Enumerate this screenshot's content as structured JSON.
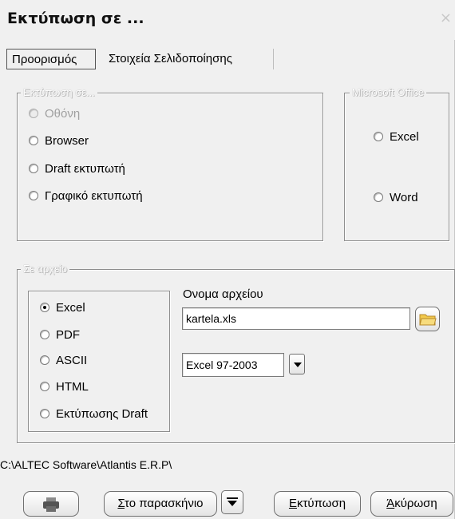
{
  "window": {
    "title": "Εκτύπωση σε ...",
    "close_glyph": "×"
  },
  "tabs": [
    {
      "label": "Προορισμός",
      "active": true
    },
    {
      "label": "Στοιχεία Σελιδοποίησης",
      "active": false
    }
  ],
  "print_to": {
    "legend": "Εκτύπωση σε...",
    "options": [
      {
        "label": "Οθόνη",
        "disabled": true,
        "selected": false
      },
      {
        "label": "Browser",
        "disabled": false,
        "selected": false
      },
      {
        "label": "Draft εκτυπωτή",
        "disabled": false,
        "selected": false
      },
      {
        "label": "Γραφικό εκτυπωτή",
        "disabled": false,
        "selected": false
      }
    ]
  },
  "office": {
    "legend": "Microsoft Office",
    "options": [
      {
        "label": "Excel",
        "selected": false
      },
      {
        "label": "Word",
        "selected": false
      }
    ]
  },
  "to_file": {
    "legend": "Σε αρχείο",
    "formats": [
      {
        "label": "Excel",
        "selected": true
      },
      {
        "label": "PDF",
        "selected": false
      },
      {
        "label": "ASCII",
        "selected": false
      },
      {
        "label": "HTML",
        "selected": false
      },
      {
        "label": "Εκτύπωσης Draft",
        "selected": false
      }
    ],
    "filename_label": "Ονομα αρχείου",
    "filename_value": "kartela.xls",
    "browse_icon": "folder-icon",
    "version_value": "Excel 97-2003"
  },
  "status_path": "C:\\ALTEC Software\\Atlantis E.R.P\\",
  "buttons": {
    "printer_icon": "printer-icon",
    "background_first": "Σ",
    "background_rest": "το παρασκήνιο",
    "print_first": "Ε",
    "print_rest": "κτύπωση",
    "cancel_first": "Ά",
    "cancel_rest": "κύρωση"
  },
  "colors": {
    "window_bg": "#f0f0f0",
    "legend_text": "#ffffff",
    "folder_icon": "#f2c94c"
  }
}
